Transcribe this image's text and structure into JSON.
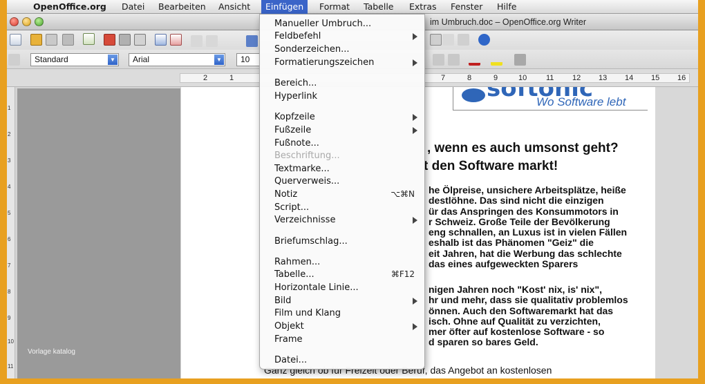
{
  "menubar": {
    "apple": "",
    "items": [
      "OpenOffice.org",
      "Datei",
      "Bearbeiten",
      "Ansicht",
      "Einfügen",
      "Format",
      "Tabelle",
      "Extras",
      "Fenster",
      "Hilfe"
    ],
    "active": "Einfügen"
  },
  "window": {
    "title": "im Umbruch.doc – OpenOffice.org Writer"
  },
  "toolbar": {
    "style_value": "Standard",
    "font_value": "Arial",
    "size_value": "10"
  },
  "ruler": {
    "left_numbers": [
      "2",
      "1"
    ],
    "right_numbers": [
      "7",
      "8",
      "9",
      "10",
      "11",
      "12",
      "13",
      "14",
      "15",
      "16"
    ]
  },
  "vruler": [
    "1",
    "2",
    "3",
    "4",
    "5",
    "6",
    "7",
    "8",
    "9",
    "10",
    "11"
  ],
  "document": {
    "logo_text": "softonic",
    "logo_slogan": "Wo Software lebt",
    "headline_1": ", wenn es auch umsonst geht?",
    "headline_2": "t den Software markt!",
    "paragraph_1": [
      "he Ölpreise, unsichere Arbeitsplätze, heiße",
      "destlöhne. Das sind nicht die einzigen",
      "ür das Anspringen des Konsummotors in",
      "r Schweiz. Große Teile der Bevölkerung",
      "eng schnallen, an Luxus ist in vielen Fällen",
      "eshalb ist das Phänomen \"Geiz\" die",
      "eit Jahren, hat die Werbung das schlechte",
      "das eines aufgeweckten Sparers"
    ],
    "paragraph_2": [
      "nigen Jahren noch \"Kost' nix, is' nix\",",
      "hr und mehr, dass sie qualitativ problemlos",
      "önnen. Auch den Softwaremarkt hat das",
      "isch. Ohne auf Qualität zu verzichten,",
      "mer öfter auf kostenlose Software - so",
      "d sparen so bares Geld."
    ],
    "last_line": "Ganz gleich ob für Freizeit oder Beruf, das Angebot an kostenlosen"
  },
  "watermark": "Vorlage katalog",
  "insert_menu": {
    "items": [
      {
        "label": "Manueller Umbruch...",
        "shortcut": "",
        "submenu": false,
        "disabled": false
      },
      {
        "label": "Feldbefehl",
        "shortcut": "",
        "submenu": true,
        "disabled": false
      },
      {
        "label": "Sonderzeichen...",
        "shortcut": "",
        "submenu": false,
        "disabled": false
      },
      {
        "label": "Formatierungszeichen",
        "shortcut": "",
        "submenu": true,
        "disabled": false
      },
      {
        "label": "Bereich...",
        "shortcut": "",
        "submenu": false,
        "disabled": false
      },
      {
        "label": "Hyperlink",
        "shortcut": "",
        "submenu": false,
        "disabled": false
      },
      {
        "label": "Kopfzeile",
        "shortcut": "",
        "submenu": true,
        "disabled": false
      },
      {
        "label": "Fußzeile",
        "shortcut": "",
        "submenu": true,
        "disabled": false
      },
      {
        "label": "Fußnote...",
        "shortcut": "",
        "submenu": false,
        "disabled": false
      },
      {
        "label": "Beschriftung...",
        "shortcut": "",
        "submenu": false,
        "disabled": true
      },
      {
        "label": "Textmarke...",
        "shortcut": "",
        "submenu": false,
        "disabled": false
      },
      {
        "label": "Querverweis...",
        "shortcut": "",
        "submenu": false,
        "disabled": false
      },
      {
        "label": "Notiz",
        "shortcut": "⌥⌘N",
        "submenu": false,
        "disabled": false
      },
      {
        "label": "Script...",
        "shortcut": "",
        "submenu": false,
        "disabled": false
      },
      {
        "label": "Verzeichnisse",
        "shortcut": "",
        "submenu": true,
        "disabled": false
      },
      {
        "label": "Briefumschlag...",
        "shortcut": "",
        "submenu": false,
        "disabled": false
      },
      {
        "label": "Rahmen...",
        "shortcut": "",
        "submenu": false,
        "disabled": false
      },
      {
        "label": "Tabelle...",
        "shortcut": "⌘F12",
        "submenu": false,
        "disabled": false
      },
      {
        "label": "Horizontale Linie...",
        "shortcut": "",
        "submenu": false,
        "disabled": false
      },
      {
        "label": "Bild",
        "shortcut": "",
        "submenu": true,
        "disabled": false
      },
      {
        "label": "Film und Klang",
        "shortcut": "",
        "submenu": false,
        "disabled": false
      },
      {
        "label": "Objekt",
        "shortcut": "",
        "submenu": true,
        "disabled": false
      },
      {
        "label": "Frame",
        "shortcut": "",
        "submenu": false,
        "disabled": false
      },
      {
        "label": "Datei...",
        "shortcut": "",
        "submenu": false,
        "disabled": false
      }
    ]
  },
  "colors": {
    "accent": "#3a64c8",
    "border": "#e8a020",
    "logo_blue": "#2f66b8"
  }
}
